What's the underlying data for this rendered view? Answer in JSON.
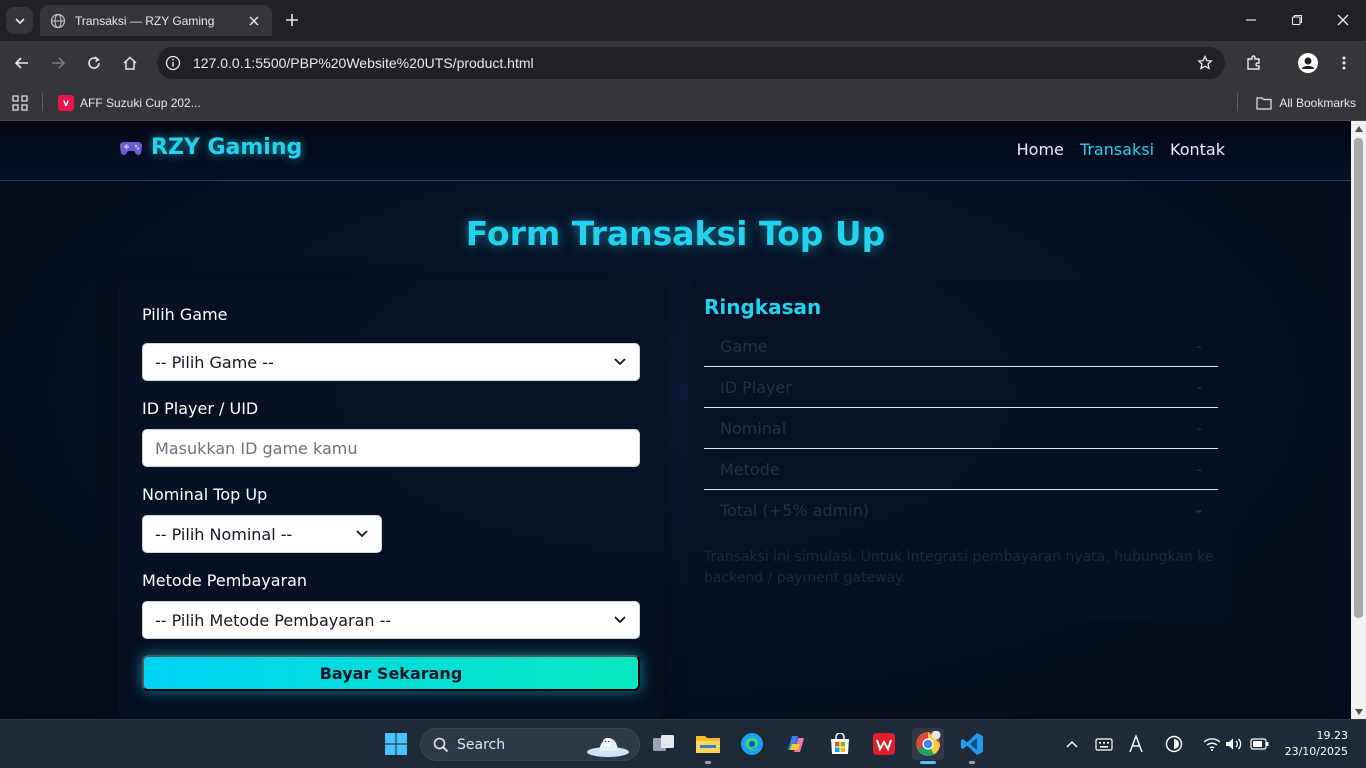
{
  "browser": {
    "tab_title": "Transaksi — RZY Gaming",
    "url": "127.0.0.1:5500/PBP%20Website%20UTS/product.html",
    "bookmark_item": "AFF Suzuki Cup 202...",
    "bookmark_icon_letter": "v",
    "all_bookmarks": "All Bookmarks"
  },
  "site": {
    "logo_text": "RZY Gaming",
    "nav": [
      "Home",
      "Transaksi",
      "Kontak"
    ],
    "active_nav": "Transaksi",
    "accent_color": "#22d3ee"
  },
  "form": {
    "page_title": "Form Transaksi Top Up",
    "game_label": "Pilih Game",
    "game_select": "-- Pilih Game --",
    "player_label": "ID Player / UID",
    "player_placeholder": "Masukkan ID game kamu",
    "nominal_label": "Nominal Top Up",
    "nominal_select": "-- Pilih Nominal --",
    "payment_label": "Metode Pembayaran",
    "payment_select": "-- Pilih Metode Pembayaran --",
    "submit_label": "Bayar Sekarang"
  },
  "summary": {
    "title": "Ringkasan",
    "rows": [
      {
        "key": "Game",
        "value": "-"
      },
      {
        "key": "ID Player",
        "value": "-"
      },
      {
        "key": "Nominal",
        "value": "-"
      },
      {
        "key": "Metode",
        "value": "-"
      },
      {
        "key": "Total (+5% admin)",
        "value": "-"
      }
    ],
    "note": "Transaksi ini simulasi. Untuk integrasi pembayaran nyata, hubungkan ke backend / payment gateway."
  },
  "taskbar": {
    "search_label": "Search",
    "time": "19.23",
    "date": "23/10/2025"
  }
}
